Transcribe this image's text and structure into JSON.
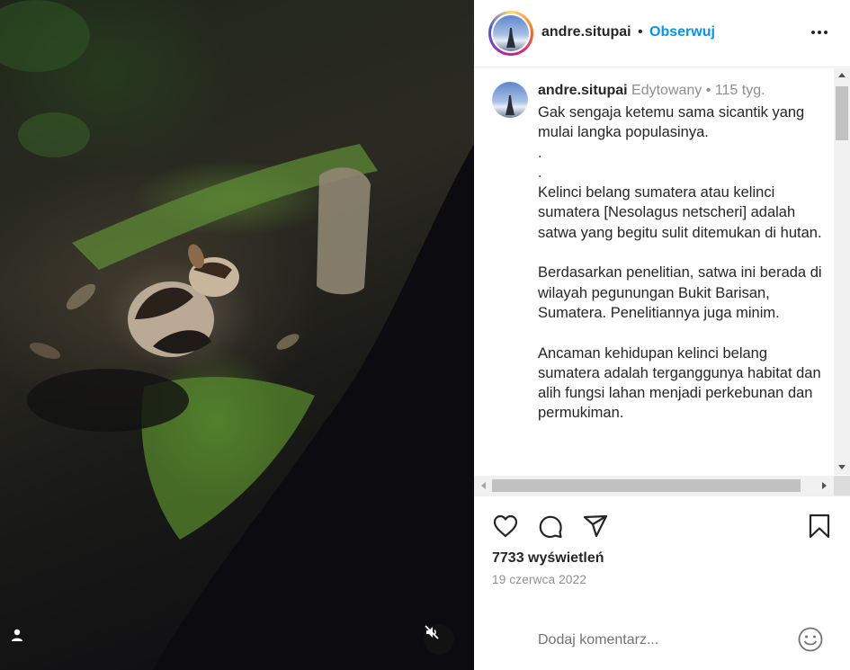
{
  "post": {
    "username": "andre.situpai",
    "follow_label": "Obserwuj",
    "separator": "•",
    "more_icon": "more-horizontal-icon"
  },
  "caption": {
    "username": "andre.situpai",
    "edited_label": "Edytowany",
    "separator": "•",
    "time_ago": "115 tyg.",
    "lines": [
      "Gak sengaja ketemu sama sicantik yang mulai langka populasinya.",
      ".",
      ".",
      "Kelinci belang sumatera atau kelinci sumatera [Nesolagus netscheri] adalah satwa yang begitu sulit ditemukan di hutan.",
      "",
      "Berdasarkan penelitian, satwa ini berada di wilayah pegunungan Bukit Barisan, Sumatera. Penelitiannya juga minim.",
      "",
      "Ancaman kehidupan kelinci belang sumatera adalah terganggunya habitat dan alih fungsi lahan menjadi perkebunan dan permukiman."
    ]
  },
  "actions": {
    "like_icon": "heart-icon",
    "comment_icon": "comment-icon",
    "share_icon": "paper-plane-icon",
    "save_icon": "bookmark-icon"
  },
  "stats": {
    "views": "7733 wyświetleń",
    "date": "19 czerwca 2022"
  },
  "comment_box": {
    "placeholder": "Dodaj komentarz...",
    "emoji_icon": "emoji-icon"
  },
  "media": {
    "user_tag_icon": "user-icon",
    "mute_icon": "muted-speaker-icon"
  },
  "colors": {
    "accent": "#0095f6",
    "text": "#262626",
    "muted": "#8e8e8e"
  }
}
